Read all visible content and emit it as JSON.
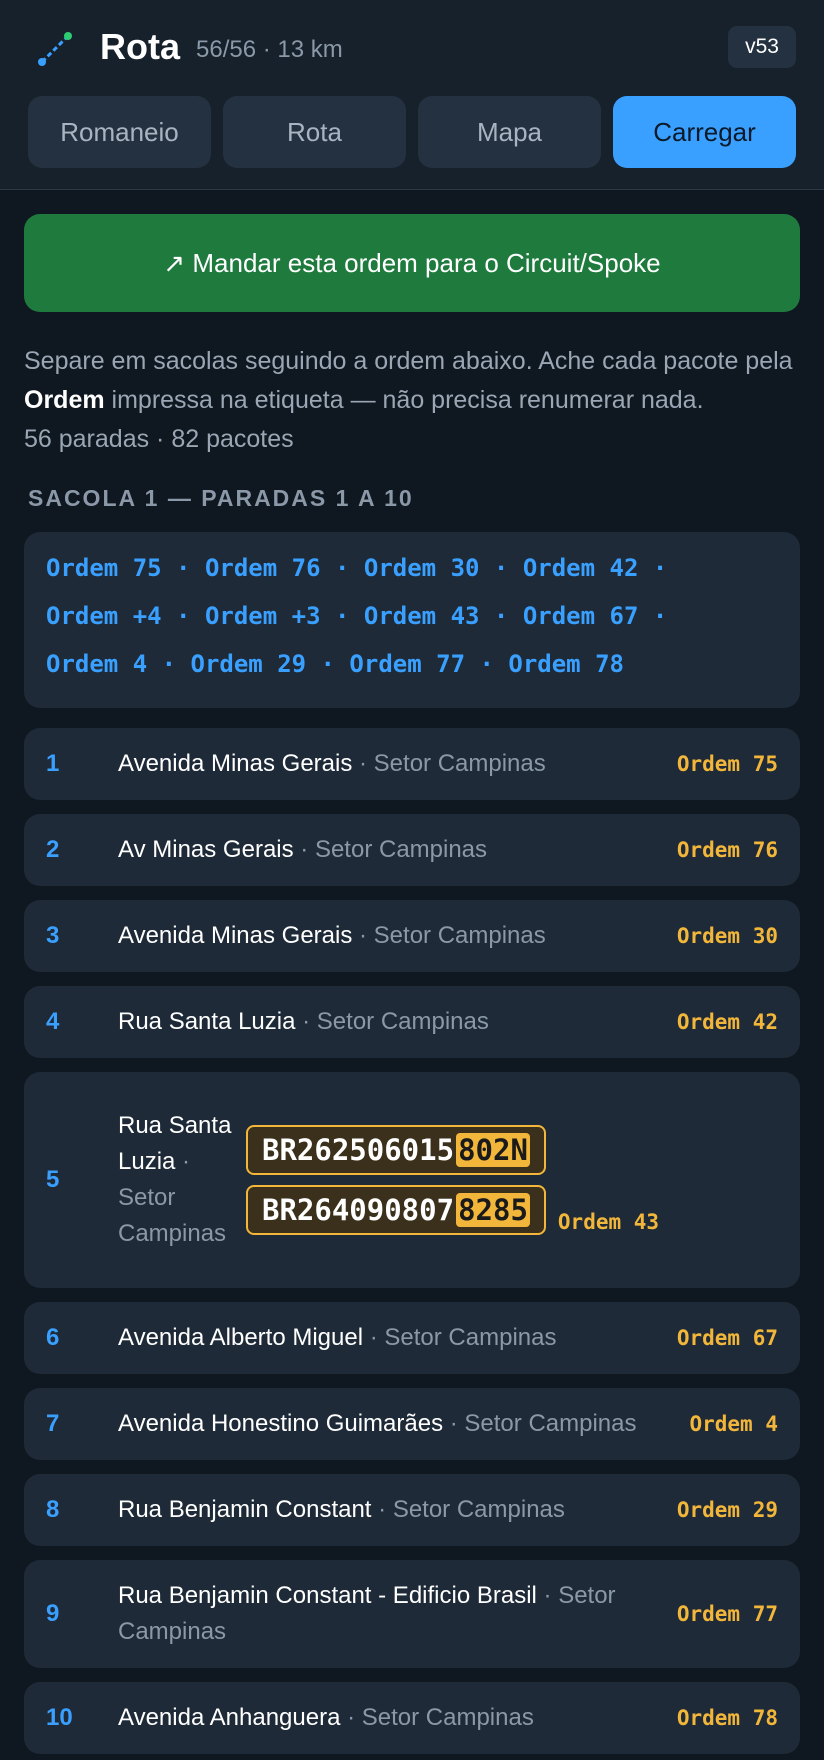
{
  "header": {
    "title": "Rota",
    "subtitle": "56/56 · 13 km",
    "version": "v53",
    "tabs": [
      {
        "label": "Romaneio",
        "active": false
      },
      {
        "label": "Rota",
        "active": false
      },
      {
        "label": "Mapa",
        "active": false
      },
      {
        "label": "Carregar",
        "active": true
      }
    ]
  },
  "export_button": "↗ Mandar esta ordem para o Circuit/Spoke",
  "instructions": {
    "part1": "Separe em sacolas seguindo a ordem abaixo. Ache cada pacote pela ",
    "bold": "Ordem",
    "part2": " impressa na etiqueta — não precisa renumerar nada.",
    "counts": "56 paradas · 82 pacotes"
  },
  "bag": {
    "title": "Sacola 1 — paradas 1 a 10",
    "summary_lines": [
      "Ordem 75 · Ordem 76 · Ordem 30 · Ordem 42 ·",
      "Ordem +4 · Ordem +3 · Ordem 43 · Ordem 67 ·",
      "Ordem 4 · Ordem 29 · Ordem 77 · Ordem 78"
    ]
  },
  "stops": [
    {
      "num": "1",
      "street": "Avenida Minas Gerais",
      "district": "Setor Campinas",
      "order": "Ordem 75"
    },
    {
      "num": "2",
      "street": "Av Minas Gerais",
      "district": "Setor Campinas",
      "order": "Ordem 76"
    },
    {
      "num": "3",
      "street": "Avenida Minas Gerais",
      "district": "Setor Campinas",
      "order": "Ordem 30"
    },
    {
      "num": "4",
      "street": "Rua Santa Luzia",
      "district": "Setor Campinas",
      "order": "Ordem 42"
    },
    {
      "num": "6",
      "street": "Avenida Alberto Miguel",
      "district": "Setor Campinas",
      "order": "Ordem 67"
    },
    {
      "num": "7",
      "street": "Avenida Honestino Guimarães",
      "district": "Setor Campinas",
      "order": "Ordem 4"
    },
    {
      "num": "8",
      "street": "Rua Benjamin Constant",
      "district": "Setor Campinas",
      "order": "Ordem 29"
    },
    {
      "num": "9",
      "street": "Rua Benjamin Constant - Edificio Brasil",
      "district": "Setor Campinas",
      "order": "Ordem 77"
    },
    {
      "num": "10",
      "street": "Avenida Anhanguera",
      "district": "Setor Campinas",
      "order": "Ordem 78"
    }
  ],
  "stop5": {
    "num": "5",
    "street": "Rua Santa Luzia",
    "district": "Setor Campinas",
    "codes": [
      {
        "prefix": "BR262506015",
        "suffix": "802N"
      },
      {
        "prefix": "BR264090807",
        "suffix": "8285"
      }
    ],
    "order": "Ordem 43"
  },
  "sep": " · ",
  "colors": {
    "accent": "#3aa0ff",
    "order": "#f2b63a",
    "export": "#1f7a3e",
    "background": "#0f1720"
  }
}
